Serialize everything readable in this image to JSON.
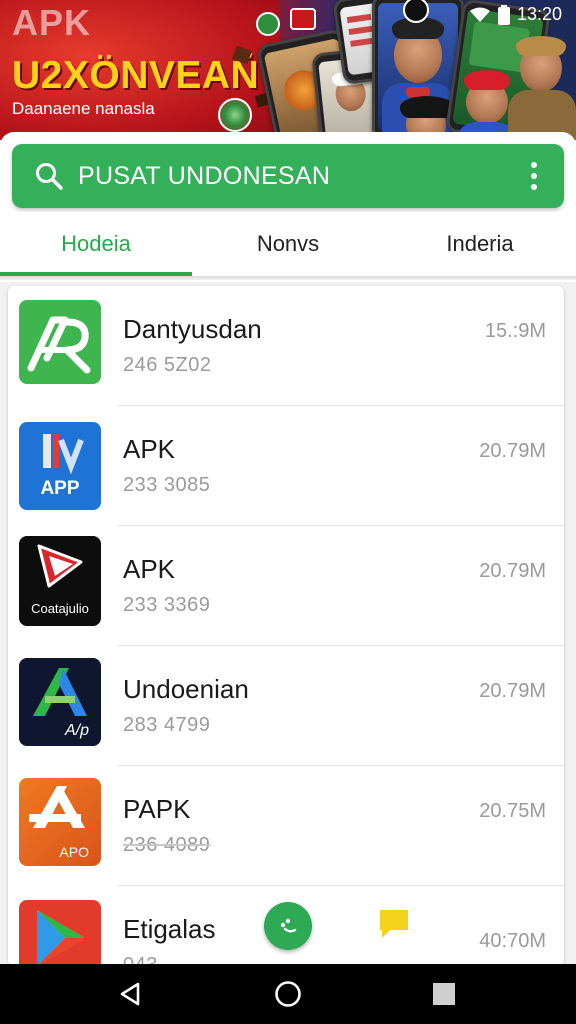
{
  "banner": {
    "watermark": "APK",
    "headline": "U2XÖNVEAÑ",
    "subtitle": "Daanaene nanasla",
    "status_time": "13:20"
  },
  "search": {
    "text": "PUSAT UNDONESAN",
    "icon": "search-icon",
    "menu_icon": "more-vert-icon"
  },
  "tabs": [
    {
      "label": "Hodeia",
      "active": true
    },
    {
      "label": "Nonvs",
      "active": false
    },
    {
      "label": "Inderia",
      "active": false
    }
  ],
  "apps": [
    {
      "name": "Dantyusdan",
      "meta": "246 5Z02",
      "size": "15.:9M",
      "icon_label": ""
    },
    {
      "name": "APK",
      "meta": "233 3085",
      "size": "20.79M",
      "icon_label": "APP"
    },
    {
      "name": "APK",
      "meta": "233 3369",
      "size": "20.79M",
      "icon_label": "Coatajulio"
    },
    {
      "name": "Undoenian",
      "meta": "283 4799",
      "size": "20.79M",
      "icon_label": "A/p"
    },
    {
      "name": "PAPK",
      "meta": "236 4089",
      "size": "20.75M",
      "icon_label": "APO"
    },
    {
      "name": "Etigalas",
      "meta": "043",
      "size": "40:70M",
      "icon_label": ""
    }
  ],
  "colors": {
    "accent": "#35b05a",
    "tab_active": "#2aa84a",
    "banner_red": "#c0171e",
    "headline_yellow": "#ffd21a"
  },
  "navbar": {
    "back_icon": "back-triangle-icon",
    "home_icon": "home-circle-icon",
    "recents_icon": "recents-square-icon"
  }
}
